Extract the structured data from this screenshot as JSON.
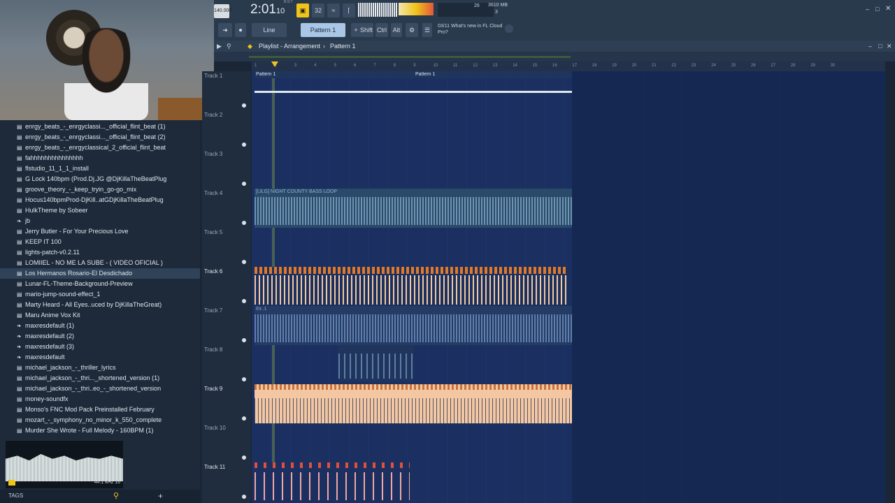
{
  "toolbar": {
    "tempo": "140.000",
    "time": "2:01",
    "time_sub": "10",
    "time_unit": "B:S:T",
    "pattern_num": "32",
    "cpu": "26",
    "mem": "3610 MB",
    "voices": "3",
    "snap": "Line",
    "pattern": "Pattern 1",
    "shift": "Shift",
    "ctrl": "Ctrl",
    "alt": "Alt",
    "news_date": "03/11",
    "news_text": "What's new in FL Cloud Pro?",
    "colors": {
      "accent": "#f0c419",
      "bg": "#2a3a4d"
    }
  },
  "playlist": {
    "title": "Playlist - Arrangement",
    "sep": "›",
    "pattern": "Pattern 1",
    "ruler": [
      "1",
      "2",
      "3",
      "4",
      "5",
      "6",
      "7",
      "8",
      "9",
      "10",
      "11",
      "12",
      "13",
      "14",
      "15",
      "16",
      "17",
      "18",
      "19",
      "20",
      "21",
      "22",
      "23",
      "24",
      "25",
      "26",
      "27",
      "28",
      "29",
      "30"
    ],
    "tracks": [
      {
        "label": "Track 1",
        "active": false
      },
      {
        "label": "Track 2",
        "active": false
      },
      {
        "label": "Track 3",
        "active": false
      },
      {
        "label": "Track 4",
        "active": false
      },
      {
        "label": "Track 5",
        "active": false
      },
      {
        "label": "Track 6",
        "active": true
      },
      {
        "label": "Track 7",
        "active": false
      },
      {
        "label": "Track 8",
        "active": false
      },
      {
        "label": "Track 9",
        "active": true
      },
      {
        "label": "Track 10",
        "active": false
      },
      {
        "label": "Track 11",
        "active": true
      }
    ],
    "clips": {
      "pattern_a": "Pattern 1",
      "pattern_b": "Pattern 1",
      "audio4": "[LILG] NIGHT COUNTY BASS LOOP",
      "audio7": "thr..1"
    }
  },
  "browser": {
    "items": [
      {
        "icon": "file",
        "label": "enrgy_beats_-_enrgyclassi..._official_flint_beat (1)"
      },
      {
        "icon": "file",
        "label": "enrgy_beats_-_enrgyclassi..._official_flint_beat (2)"
      },
      {
        "icon": "file",
        "label": "enrgy_beats_-_enrgyclassical_2_official_flint_beat"
      },
      {
        "icon": "file",
        "label": "fahhhhhhhhhhhhhhh"
      },
      {
        "icon": "file",
        "label": "flstudio_11_1_1_install"
      },
      {
        "icon": "file",
        "label": "G Lock 140bpm (Prod.Dj.JG @DjKillaTheBeatPlug"
      },
      {
        "icon": "file",
        "label": "groove_theory_-_keep_tryin_go-go_mix"
      },
      {
        "icon": "file",
        "label": "Hocus140bpmProd-DjKill..atGDjKillaTheBeatPlug"
      },
      {
        "icon": "file",
        "label": "HulkTheme by Sobeer"
      },
      {
        "icon": "fruit",
        "label": "jb"
      },
      {
        "icon": "file",
        "label": "Jerry Butler - For Your Precious Love"
      },
      {
        "icon": "file",
        "label": "KEEP IT 100"
      },
      {
        "icon": "file",
        "label": "lights-patch-v0.2.11"
      },
      {
        "icon": "file",
        "label": "LOMIIEL - NO ME LA SUBE - ( VIDEO OFICIAL )"
      },
      {
        "icon": "file",
        "label": "Los Hermanos Rosario-El Desdichado"
      },
      {
        "icon": "file",
        "label": "Lunar-FL-Theme-Background-Preview"
      },
      {
        "icon": "file",
        "label": "mario-jump-sound-effect_1"
      },
      {
        "icon": "file",
        "label": "Marty Heard - All Eyes..uced by DjKillaTheGreat)"
      },
      {
        "icon": "file",
        "label": "Maru Anime Vox Kit"
      },
      {
        "icon": "fruit",
        "label": "maxresdefault (1)"
      },
      {
        "icon": "fruit",
        "label": "maxresdefault (2)"
      },
      {
        "icon": "fruit",
        "label": "maxresdefault (3)"
      },
      {
        "icon": "fruit",
        "label": "maxresdefault"
      },
      {
        "icon": "file",
        "label": "michael_jackson_-_thriller_lyrics"
      },
      {
        "icon": "file",
        "label": "michael_jackson_-_thri..._shortened_version (1)"
      },
      {
        "icon": "file",
        "label": "michael_jackson_-_thri..eo_-_shortened_version"
      },
      {
        "icon": "file",
        "label": "money-soundfx"
      },
      {
        "icon": "file",
        "label": "Monso's FNC Mod Pack Preinstalled February"
      },
      {
        "icon": "file",
        "label": "mozart_-_symphony_no_minor_k_550_complete"
      },
      {
        "icon": "file",
        "label": "Murder She Wrote - Full Melody - 160BPM (1)"
      }
    ],
    "selected_index": 14,
    "sample_info": "44.1 kHz 16",
    "tags": "TAGS",
    "add": "+"
  }
}
